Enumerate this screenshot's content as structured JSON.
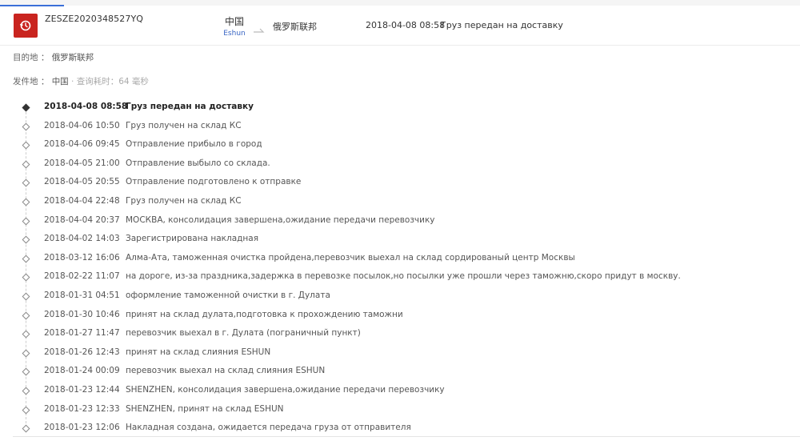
{
  "tracking": {
    "number": "ZESZE2020348527YQ",
    "origin_country": "中国",
    "carrier": "Eshun",
    "destination_country": "俄罗斯联邦",
    "last_event_time": "2018-04-08 08:58",
    "last_event_status": "Груз передан на доставку"
  },
  "info": {
    "destination_label": "目的地",
    "destination_sep": "：",
    "destination_value": "俄罗斯联邦",
    "origin_label": "发件地",
    "origin_sep": "：",
    "origin_value": "中国",
    "query_time_text": "· 查询耗时：64 毫秒"
  },
  "events": [
    {
      "time": "2018-04-08 08:58",
      "desc": "Груз передан на доставку",
      "active": true
    },
    {
      "time": "2018-04-06 10:50",
      "desc": "Груз получен на склад КС"
    },
    {
      "time": "2018-04-06 09:45",
      "desc": "Отправление прибыло в город"
    },
    {
      "time": "2018-04-05 21:00",
      "desc": "Отправление выбыло со склада."
    },
    {
      "time": "2018-04-05 20:55",
      "desc": "Отправление подготовлено к отправке"
    },
    {
      "time": "2018-04-04 22:48",
      "desc": "Груз получен на склад КС"
    },
    {
      "time": "2018-04-04 20:37",
      "desc": "МОСКВА, консолидация завершена,ожидание передачи перевозчику"
    },
    {
      "time": "2018-04-02 14:03",
      "desc": "Зарегистрирована накладная"
    },
    {
      "time": "2018-03-12 16:06",
      "desc": "Алма-Ата, таможенная очистка пройдена,перевозчик выехал на склад сордированый центр Москвы"
    },
    {
      "time": "2018-02-22 11:07",
      "desc": "на дороге, из-за праздника,задержка в перевозке посылок,но посылки уже прошли через таможню,скоро придут в москву."
    },
    {
      "time": "2018-01-31 04:51",
      "desc": "оформление таможенной очистки в г. Дулата"
    },
    {
      "time": "2018-01-30 10:46",
      "desc": "принят на склад дулата,подготовка к прохождению таможни"
    },
    {
      "time": "2018-01-27 11:47",
      "desc": "перевозчик выехал в г. Дулата (пограничный пункт)"
    },
    {
      "time": "2018-01-26 12:43",
      "desc": "принят на склад слияния ESHUN"
    },
    {
      "time": "2018-01-24 00:09",
      "desc": "перевозчик выехал на склад слияния ESHUN"
    },
    {
      "time": "2018-01-23 12:44",
      "desc": "SHENZHEN, консолидация завершена,ожидание передачи перевозчику"
    },
    {
      "time": "2018-01-23 12:33",
      "desc": "SHENZHEN, принят на склад ESHUN"
    },
    {
      "time": "2018-01-23 12:06",
      "desc": "Накладная создана, ожидается передача груза от отправителя"
    }
  ],
  "icons": {
    "logo": "history-icon",
    "arrow": "route-arrow-icon"
  },
  "colors": {
    "logo_bg": "#c9241f",
    "carrier_text": "#3a66c4",
    "tab_accent": "#3b6fd8"
  }
}
